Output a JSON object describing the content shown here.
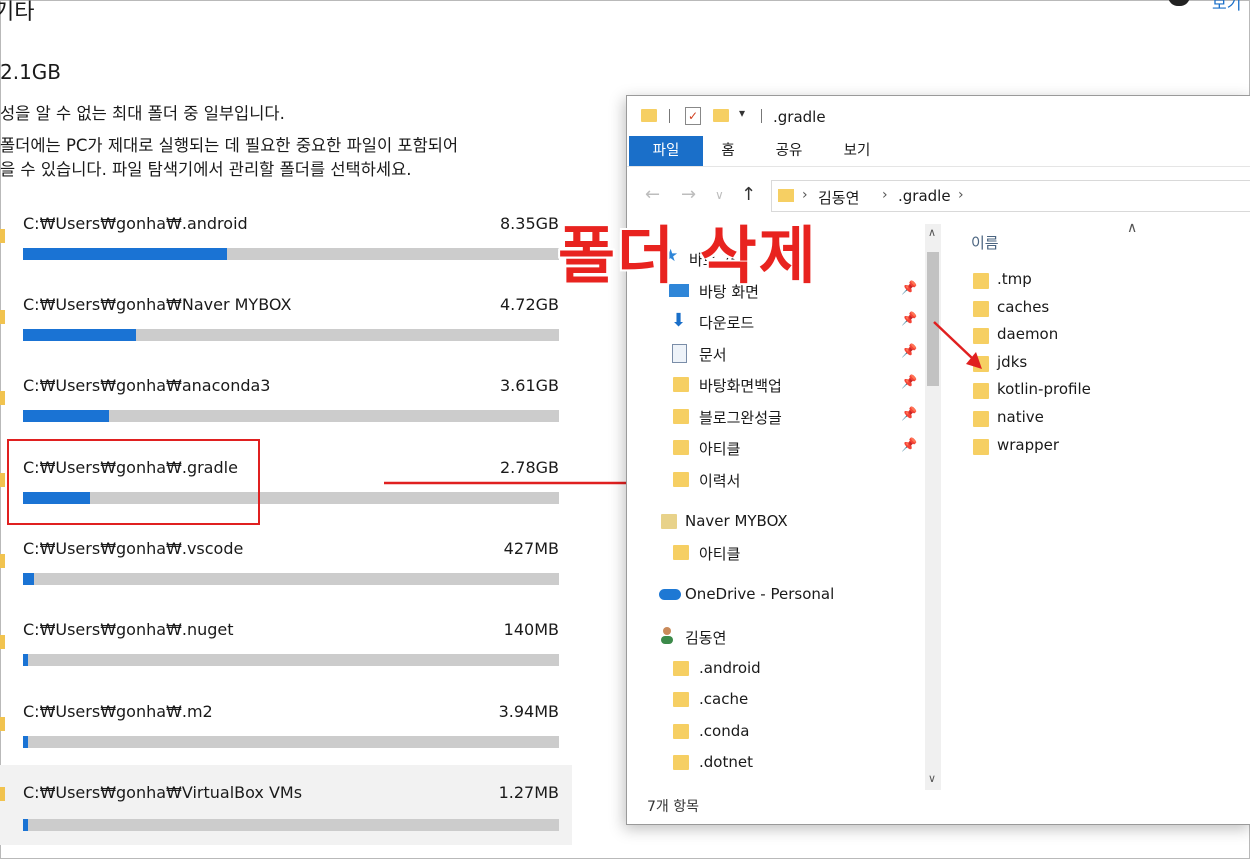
{
  "settings": {
    "category_title": "기타",
    "total_size": "2.1GB",
    "desc_line1": "성을 알 수 없는 최대 폴더 중 일부입니다.",
    "desc_line2": "폴더에는 PC가 제대로 실행되는 데 필요한 중요한 파일이 포함되어",
    "desc_line3": "을 수 있습니다. 파일 탐색기에서 관리할 폴더를 선택하세요.",
    "top_right_link": "보기",
    "accent_color": "#1a73d4",
    "folders": [
      {
        "path": "C:₩Users₩gonha₩.android",
        "size": "8.35GB",
        "fraction": 0.38
      },
      {
        "path": "C:₩Users₩gonha₩Naver MYBOX",
        "size": "4.72GB",
        "fraction": 0.21
      },
      {
        "path": "C:₩Users₩gonha₩anaconda3",
        "size": "3.61GB",
        "fraction": 0.16
      },
      {
        "path": "C:₩Users₩gonha₩.gradle",
        "size": "2.78GB",
        "fraction": 0.125
      },
      {
        "path": "C:₩Users₩gonha₩.vscode",
        "size": "427MB",
        "fraction": 0.02
      },
      {
        "path": "C:₩Users₩gonha₩.nuget",
        "size": "140MB",
        "fraction": 0.01
      },
      {
        "path": "C:₩Users₩gonha₩.m2",
        "size": "3.94MB",
        "fraction": 0.01
      },
      {
        "path": "C:₩Users₩gonha₩VirtualBox VMs",
        "size": "1.27MB",
        "fraction": 0.01
      }
    ]
  },
  "overlay": {
    "headline": "폴더 삭제",
    "highlight_color": "#e8231f"
  },
  "explorer": {
    "title": ".gradle",
    "ribbon_tabs": [
      "파일",
      "홈",
      "공유",
      "보기"
    ],
    "breadcrumb": [
      "김동연",
      ".gradle"
    ],
    "nav": {
      "quick_access": "바로 가기",
      "quick_items": [
        "바탕 화면",
        "다운로드",
        "문서",
        "바탕화면백업",
        "블로그완성글",
        "아티클",
        "이력서"
      ],
      "naver": "Naver MYBOX",
      "naver_items": [
        "아티클"
      ],
      "onedrive": "OneDrive - Personal",
      "user": "김동연",
      "user_items": [
        ".android",
        ".cache",
        ".conda",
        ".dotnet"
      ]
    },
    "column_header": "이름",
    "items": [
      ".tmp",
      "caches",
      "daemon",
      "jdks",
      "kotlin-profile",
      "native",
      "wrapper"
    ],
    "status": "7개 항목"
  }
}
